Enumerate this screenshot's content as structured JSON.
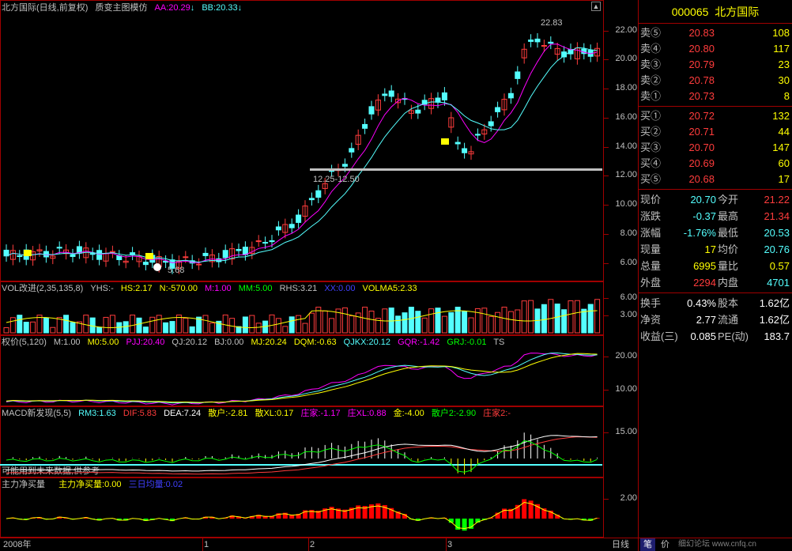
{
  "main_header": {
    "title": "北方国际(日线,前复权)",
    "indicator": "质变主图模仿",
    "aa": "AA:20.29",
    "bb": "BB:20.33",
    "high_label": "22.83",
    "low_label": "5.68",
    "range_label": "12.25-12.50",
    "y_ticks": [
      "22.00",
      "20.00",
      "18.00",
      "16.00",
      "14.00",
      "12.00",
      "10.00",
      "8.00",
      "6.00"
    ]
  },
  "vol_header": {
    "name": "VOL改进(2,35,135,8)",
    "yhs": "YHS:-",
    "hs": "HS:2.17",
    "n": "N:-570.00",
    "m": "M:1.00",
    "mm": "MM:5.00",
    "rhs": "RHS:3.21",
    "xx": "XX:0.00",
    "volma": "VOLMA5:2.33",
    "y_ticks": [
      "6.00",
      "3.00"
    ]
  },
  "qj_header": {
    "name": "权价(5,120)",
    "m": "M:1.00",
    "m0": "M0:5.00",
    "pjj": "PJJ:20.40",
    "qj": "QJ:20.12",
    "bj": "BJ:0.00",
    "mj": "MJ:20.24",
    "dqm": "DQM:-0.63",
    "qjkx": "QJKX:20.12",
    "gqr": "GQR:-1.42",
    "grj": "GRJ:-0.01",
    "ts": "TS",
    "y_ticks": [
      "20.00",
      "10.00"
    ]
  },
  "macd_header": {
    "name": "MACD新发现(5,5)",
    "rm3": "RM3:1.63",
    "dif": "DIF:5.83",
    "dea": "DEA:7.24",
    "sh": "散户:-2.81",
    "sxl": "散XL:0.17",
    "zj": "庄家:-1.17",
    "zxl": "庄XL:0.88",
    "jin": "金:-4.00",
    "sh2": "散户2:-2.90",
    "zj2": "庄家2:-",
    "note": "可能用到未来数据,供参考",
    "y_ticks": [
      "15.00"
    ]
  },
  "flow_header": {
    "name": "主力净买量",
    "zl": "主力净买量:0.00",
    "avg": "三日均量:0.02",
    "y_ticks": [
      "2.00"
    ]
  },
  "x_axis": {
    "labels": [
      "2008年",
      "1",
      "2",
      "3"
    ]
  },
  "quote": {
    "code": "000065",
    "name": "北方国际",
    "asks": [
      {
        "label": "卖⑤",
        "price": "20.83",
        "vol": "108"
      },
      {
        "label": "卖④",
        "price": "20.80",
        "vol": "117"
      },
      {
        "label": "卖③",
        "price": "20.79",
        "vol": "23"
      },
      {
        "label": "卖②",
        "price": "20.78",
        "vol": "30"
      },
      {
        "label": "卖①",
        "price": "20.73",
        "vol": "8"
      }
    ],
    "bids": [
      {
        "label": "买①",
        "price": "20.72",
        "vol": "132"
      },
      {
        "label": "买②",
        "price": "20.71",
        "vol": "44"
      },
      {
        "label": "买③",
        "price": "20.70",
        "vol": "147"
      },
      {
        "label": "买④",
        "price": "20.69",
        "vol": "60"
      },
      {
        "label": "买⑤",
        "price": "20.68",
        "vol": "17"
      }
    ],
    "stats": [
      {
        "k1": "现价",
        "v1": "20.70",
        "k2": "今开",
        "v2": "21.22"
      },
      {
        "k1": "涨跌",
        "v1": "-0.37",
        "k2": "最高",
        "v2": "21.34"
      },
      {
        "k1": "涨幅",
        "v1": "-1.76%",
        "k2": "最低",
        "v2": "20.53"
      },
      {
        "k1": "现量",
        "v1": "17",
        "k2": "均价",
        "v2": "20.76"
      },
      {
        "k1": "总量",
        "v1": "6995",
        "k2": "量比",
        "v2": "0.57"
      },
      {
        "k1": "外盘",
        "v1": "2294",
        "k2": "内盘",
        "v2": "4701"
      }
    ],
    "stats2": [
      {
        "k1": "换手",
        "v1": "0.43%",
        "k2": "股本",
        "v2": "1.62亿"
      },
      {
        "k1": "净资",
        "v1": "2.77",
        "k2": "流通",
        "v2": "1.62亿"
      },
      {
        "k1": "收益(三)",
        "v1": "0.085",
        "k2": "PE(动)",
        "v2": "183.7"
      }
    ]
  },
  "bottom_tabs": {
    "day": "日线",
    "bi": "笔",
    "jia": "价",
    "watermark": "细幻论坛 www.cnfq.cn"
  },
  "colors": {
    "up": "#ff3c3c",
    "down": "#54ffff",
    "ma1": "#ff00ff",
    "ma2": "#54ffff",
    "yellow": "#ffff00",
    "border": "#a00000"
  }
}
